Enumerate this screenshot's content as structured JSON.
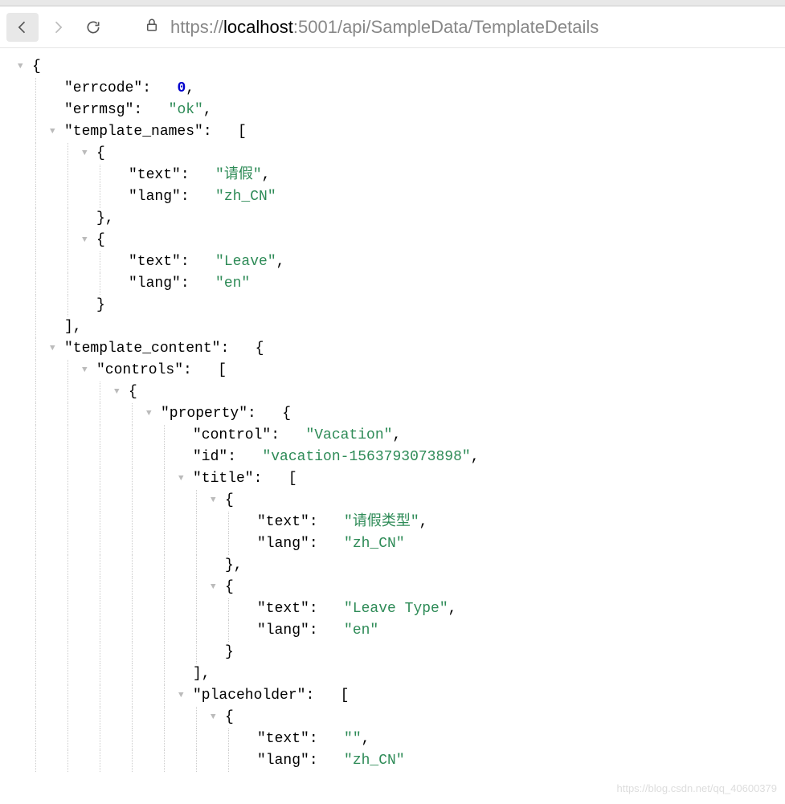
{
  "toolbar": {
    "url_protocol": "https://",
    "url_host": "localhost",
    "url_port": ":5001",
    "url_path": "/api/SampleData/TemplateDetails"
  },
  "json_lines": [
    {
      "indent": 1,
      "toggle": true,
      "content": [
        {
          "t": "punc",
          "v": "{"
        }
      ]
    },
    {
      "indent": 3,
      "content": [
        {
          "t": "key",
          "v": "\"errcode\""
        },
        {
          "t": "punc",
          "v": ":   "
        },
        {
          "t": "num",
          "v": "0"
        },
        {
          "t": "punc",
          "v": ","
        }
      ]
    },
    {
      "indent": 3,
      "content": [
        {
          "t": "key",
          "v": "\"errmsg\""
        },
        {
          "t": "punc",
          "v": ":   "
        },
        {
          "t": "str",
          "v": "\"ok\""
        },
        {
          "t": "punc",
          "v": ","
        }
      ]
    },
    {
      "indent": 3,
      "toggle": true,
      "content": [
        {
          "t": "key",
          "v": "\"template_names\""
        },
        {
          "t": "punc",
          "v": ":   ["
        }
      ]
    },
    {
      "indent": 5,
      "toggle": true,
      "content": [
        {
          "t": "punc",
          "v": "{"
        }
      ]
    },
    {
      "indent": 7,
      "content": [
        {
          "t": "key",
          "v": "\"text\""
        },
        {
          "t": "punc",
          "v": ":   "
        },
        {
          "t": "str",
          "v": "\"请假\""
        },
        {
          "t": "punc",
          "v": ","
        }
      ]
    },
    {
      "indent": 7,
      "content": [
        {
          "t": "key",
          "v": "\"lang\""
        },
        {
          "t": "punc",
          "v": ":   "
        },
        {
          "t": "str",
          "v": "\"zh_CN\""
        }
      ]
    },
    {
      "indent": 5,
      "content": [
        {
          "t": "punc",
          "v": "},"
        }
      ]
    },
    {
      "indent": 5,
      "toggle": true,
      "content": [
        {
          "t": "punc",
          "v": "{"
        }
      ]
    },
    {
      "indent": 7,
      "content": [
        {
          "t": "key",
          "v": "\"text\""
        },
        {
          "t": "punc",
          "v": ":   "
        },
        {
          "t": "str",
          "v": "\"Leave\""
        },
        {
          "t": "punc",
          "v": ","
        }
      ]
    },
    {
      "indent": 7,
      "content": [
        {
          "t": "key",
          "v": "\"lang\""
        },
        {
          "t": "punc",
          "v": ":   "
        },
        {
          "t": "str",
          "v": "\"en\""
        }
      ]
    },
    {
      "indent": 5,
      "content": [
        {
          "t": "punc",
          "v": "}"
        }
      ]
    },
    {
      "indent": 3,
      "content": [
        {
          "t": "punc",
          "v": "],"
        }
      ]
    },
    {
      "indent": 3,
      "toggle": true,
      "content": [
        {
          "t": "key",
          "v": "\"template_content\""
        },
        {
          "t": "punc",
          "v": ":   {"
        }
      ]
    },
    {
      "indent": 5,
      "toggle": true,
      "content": [
        {
          "t": "key",
          "v": "\"controls\""
        },
        {
          "t": "punc",
          "v": ":   ["
        }
      ]
    },
    {
      "indent": 7,
      "toggle": true,
      "content": [
        {
          "t": "punc",
          "v": "{"
        }
      ]
    },
    {
      "indent": 9,
      "toggle": true,
      "content": [
        {
          "t": "key",
          "v": "\"property\""
        },
        {
          "t": "punc",
          "v": ":   {"
        }
      ]
    },
    {
      "indent": 11,
      "content": [
        {
          "t": "key",
          "v": "\"control\""
        },
        {
          "t": "punc",
          "v": ":   "
        },
        {
          "t": "str",
          "v": "\"Vacation\""
        },
        {
          "t": "punc",
          "v": ","
        }
      ]
    },
    {
      "indent": 11,
      "content": [
        {
          "t": "key",
          "v": "\"id\""
        },
        {
          "t": "punc",
          "v": ":   "
        },
        {
          "t": "str",
          "v": "\"vacation-1563793073898\""
        },
        {
          "t": "punc",
          "v": ","
        }
      ]
    },
    {
      "indent": 11,
      "toggle": true,
      "content": [
        {
          "t": "key",
          "v": "\"title\""
        },
        {
          "t": "punc",
          "v": ":   ["
        }
      ]
    },
    {
      "indent": 13,
      "toggle": true,
      "content": [
        {
          "t": "punc",
          "v": "{"
        }
      ]
    },
    {
      "indent": 15,
      "content": [
        {
          "t": "key",
          "v": "\"text\""
        },
        {
          "t": "punc",
          "v": ":   "
        },
        {
          "t": "str",
          "v": "\"请假类型\""
        },
        {
          "t": "punc",
          "v": ","
        }
      ]
    },
    {
      "indent": 15,
      "content": [
        {
          "t": "key",
          "v": "\"lang\""
        },
        {
          "t": "punc",
          "v": ":   "
        },
        {
          "t": "str",
          "v": "\"zh_CN\""
        }
      ]
    },
    {
      "indent": 13,
      "content": [
        {
          "t": "punc",
          "v": "},"
        }
      ]
    },
    {
      "indent": 13,
      "toggle": true,
      "content": [
        {
          "t": "punc",
          "v": "{"
        }
      ]
    },
    {
      "indent": 15,
      "content": [
        {
          "t": "key",
          "v": "\"text\""
        },
        {
          "t": "punc",
          "v": ":   "
        },
        {
          "t": "str",
          "v": "\"Leave Type\""
        },
        {
          "t": "punc",
          "v": ","
        }
      ]
    },
    {
      "indent": 15,
      "content": [
        {
          "t": "key",
          "v": "\"lang\""
        },
        {
          "t": "punc",
          "v": ":   "
        },
        {
          "t": "str",
          "v": "\"en\""
        }
      ]
    },
    {
      "indent": 13,
      "content": [
        {
          "t": "punc",
          "v": "}"
        }
      ]
    },
    {
      "indent": 11,
      "content": [
        {
          "t": "punc",
          "v": "],"
        }
      ]
    },
    {
      "indent": 11,
      "toggle": true,
      "content": [
        {
          "t": "key",
          "v": "\"placeholder\""
        },
        {
          "t": "punc",
          "v": ":   ["
        }
      ]
    },
    {
      "indent": 13,
      "toggle": true,
      "content": [
        {
          "t": "punc",
          "v": "{"
        }
      ]
    },
    {
      "indent": 15,
      "content": [
        {
          "t": "key",
          "v": "\"text\""
        },
        {
          "t": "punc",
          "v": ":   "
        },
        {
          "t": "str",
          "v": "\"\""
        },
        {
          "t": "punc",
          "v": ","
        }
      ]
    },
    {
      "indent": 15,
      "content": [
        {
          "t": "key",
          "v": "\"lang\""
        },
        {
          "t": "punc",
          "v": ":   "
        },
        {
          "t": "str",
          "v": "\"zh_CN\""
        }
      ]
    }
  ],
  "watermark": "https://blog.csdn.net/qq_40600379"
}
